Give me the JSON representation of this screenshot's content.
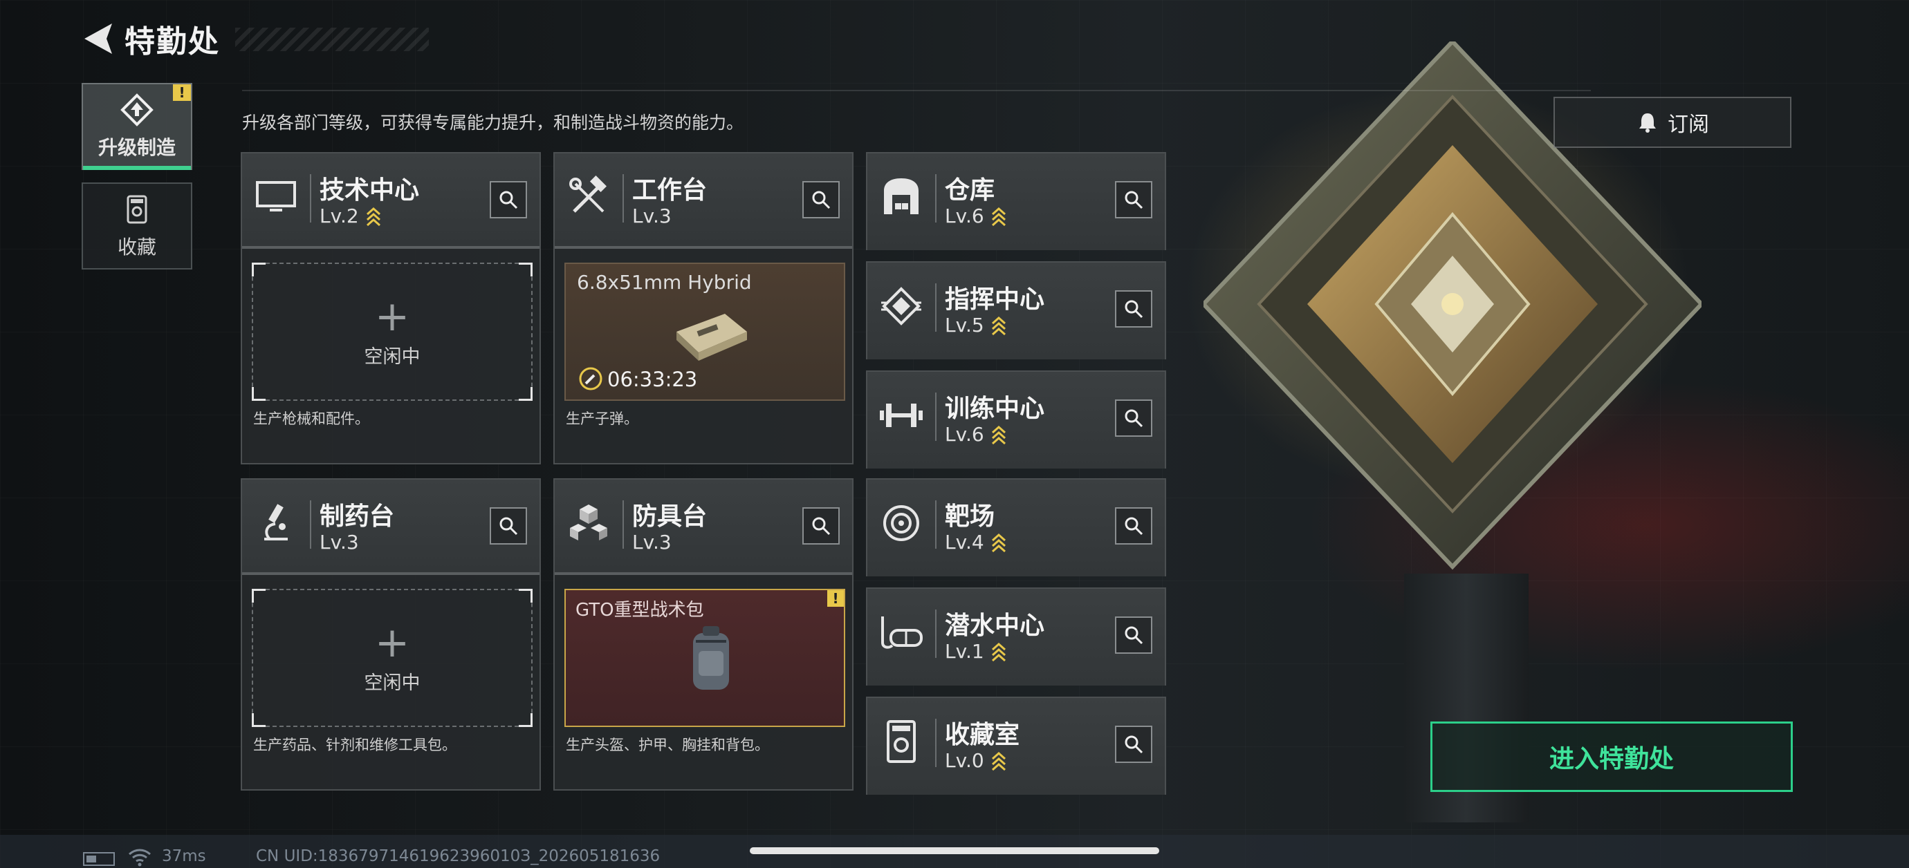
{
  "header": {
    "title": "特勤处"
  },
  "tabs": [
    {
      "label": "升级制造",
      "active": true,
      "badge": "!"
    },
    {
      "label": "收藏",
      "active": false
    }
  ],
  "description": "升级各部门等级，可获得专属能力提升，和制造战斗物资的能力。",
  "subscribe_label": "订阅",
  "enter_label": "进入特勤处",
  "cards": {
    "tech": {
      "name": "技术中心",
      "level": "Lv.2",
      "idle": "空闲中",
      "footer": "生产枪械和配件。",
      "icon": "monitor-icon"
    },
    "workbench": {
      "name": "工作台",
      "level": "Lv.3",
      "item": "6.8x51mm Hybrid",
      "timer": "06:33:23",
      "footer": "生产子弹。",
      "icon": "hammer-wrench-icon"
    },
    "pharmacy": {
      "name": "制药台",
      "level": "Lv.3",
      "idle": "空闲中",
      "footer": "生产药品、针剂和维修工具包。",
      "icon": "microscope-icon"
    },
    "armor": {
      "name": "防具台",
      "level": "Lv.3",
      "item": "GTO重型战术包",
      "badge": "!",
      "footer": "生产头盔、护甲、胸挂和背包。",
      "icon": "cubes-icon"
    },
    "warehouse": {
      "name": "仓库",
      "level": "Lv.6",
      "icon": "warehouse-icon"
    },
    "command": {
      "name": "指挥中心",
      "level": "Lv.5",
      "icon": "chip-icon"
    },
    "training": {
      "name": "训练中心",
      "level": "Lv.6",
      "icon": "dumbbell-icon"
    },
    "range": {
      "name": "靶场",
      "level": "Lv.4",
      "icon": "target-icon"
    },
    "diving": {
      "name": "潜水中心",
      "level": "Lv.1",
      "icon": "diving-mask-icon"
    },
    "collection": {
      "name": "收藏室",
      "level": "Lv.0",
      "icon": "collection-icon"
    }
  },
  "status": {
    "ping": "37ms",
    "uid": "CN UID:18367971461962396010З_202605181636"
  },
  "colors": {
    "accent": "#3fd08f",
    "level_up": "#e8c84a",
    "enter_border": "#2ccf8a"
  }
}
